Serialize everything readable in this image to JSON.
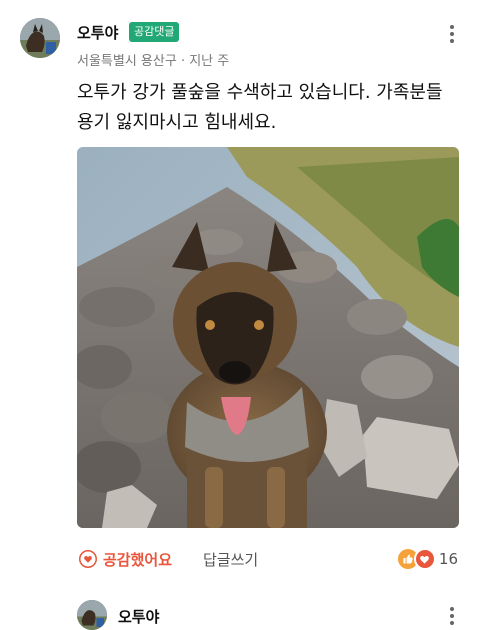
{
  "comment": {
    "author": "오투야",
    "badge": "공감댓글",
    "meta": "서울특별시 용산구 · 지난 주",
    "text": "오투가  강가 풀숲을 수색하고 있습니다. 가족분들 용기 잃지마시고 힘내세요.",
    "like_label": "공감했어요",
    "reply_label": "답글쓰기",
    "reaction_count": "16"
  },
  "next_comment": {
    "author": "오투야"
  },
  "colors": {
    "badge": "#22a877",
    "like": "#e8563c",
    "thumbs_reaction": "#f5a23a",
    "heart_reaction": "#e8563c"
  },
  "icons": {
    "more": "more-vertical-icon",
    "like": "heart-outline-icon",
    "thumbs": "thumbs-up-icon",
    "heart": "heart-icon"
  }
}
